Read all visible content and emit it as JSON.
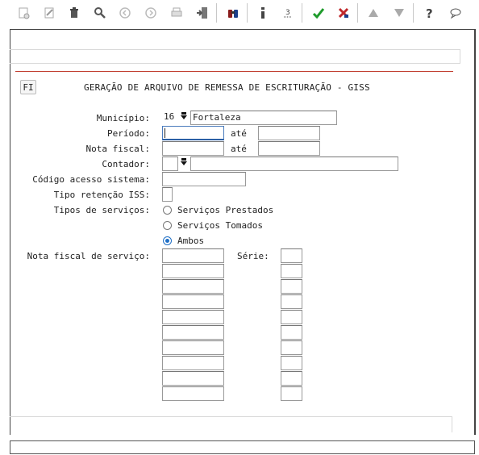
{
  "form": {
    "fi_button": "FI",
    "title": "GERAÇÃO DE ARQUIVO DE REMESSA DE ESCRITURAÇÃO - GISS",
    "municipio_label": "Município:",
    "municipio_code": "16",
    "municipio_name": "Fortaleza",
    "periodo_label": "Período:",
    "periodo_from": "",
    "periodo_ate": "até",
    "periodo_to": "",
    "nota_label": "Nota fiscal:",
    "nota_from": "",
    "nota_ate": "até",
    "nota_to": "",
    "contador_label": "Contador:",
    "contador_code": "",
    "contador_name": "",
    "codigo_label": "Código acesso sistema:",
    "codigo_value": "",
    "retencao_label": "Tipo retenção ISS:",
    "retencao_value": "",
    "tipos_label": "Tipos de serviços:",
    "tipos_options": [
      "Serviços Prestados",
      "Serviços Tomados",
      "Ambos"
    ],
    "tipos_selected": "Ambos",
    "nfs_label": "Nota fiscal de serviço:",
    "serie_label": "Série:",
    "nfs_rows": 10
  }
}
